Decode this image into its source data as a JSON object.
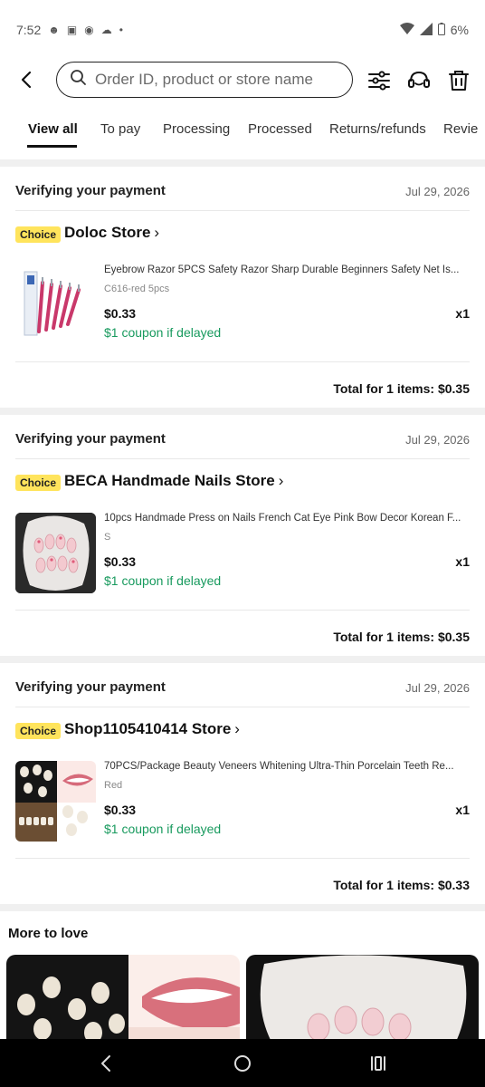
{
  "status_bar": {
    "time": "7:52",
    "battery": "6%"
  },
  "search": {
    "placeholder": "Order ID, product or store name"
  },
  "tabs": [
    {
      "label": "View all",
      "active": true
    },
    {
      "label": "To pay"
    },
    {
      "label": "Processing"
    },
    {
      "label": "Processed"
    },
    {
      "label": "Returns/refunds"
    },
    {
      "label": "Revie"
    }
  ],
  "orders": [
    {
      "status": "Verifying your payment",
      "date": "Jul 29, 2026",
      "badge": "Choice",
      "store": "Doloc Store",
      "product_title": "Eyebrow Razor 5PCS Safety Razor Sharp Durable Beginners Safety Net Is...",
      "variant": "C616-red 5pcs",
      "price": "$0.33",
      "qty": "x1",
      "coupon": "$1 coupon if delayed",
      "total": "Total for 1 items: $0.35"
    },
    {
      "status": "Verifying your payment",
      "date": "Jul 29, 2026",
      "badge": "Choice",
      "store": "BECA Handmade Nails Store",
      "product_title": "10pcs Handmade Press on Nails French Cat Eye Pink Bow Decor Korean F...",
      "variant": "S",
      "price": "$0.33",
      "qty": "x1",
      "coupon": "$1 coupon if delayed",
      "total": "Total for 1 items: $0.35"
    },
    {
      "status": "Verifying your payment",
      "date": "Jul 29, 2026",
      "badge": "Choice",
      "store": "Shop1105410414 Store",
      "product_title": "70PCS/Package Beauty Veneers Whitening Ultra-Thin Porcelain Teeth Re...",
      "variant": "Red",
      "price": "$0.33",
      "qty": "x1",
      "coupon": "$1 coupon if delayed",
      "total": "Total for 1 items: $0.33"
    }
  ],
  "more_to_love": {
    "title": "More to love"
  },
  "colors": {
    "accent_green": "#189a5e",
    "choice_yellow": "#ffe45c"
  }
}
